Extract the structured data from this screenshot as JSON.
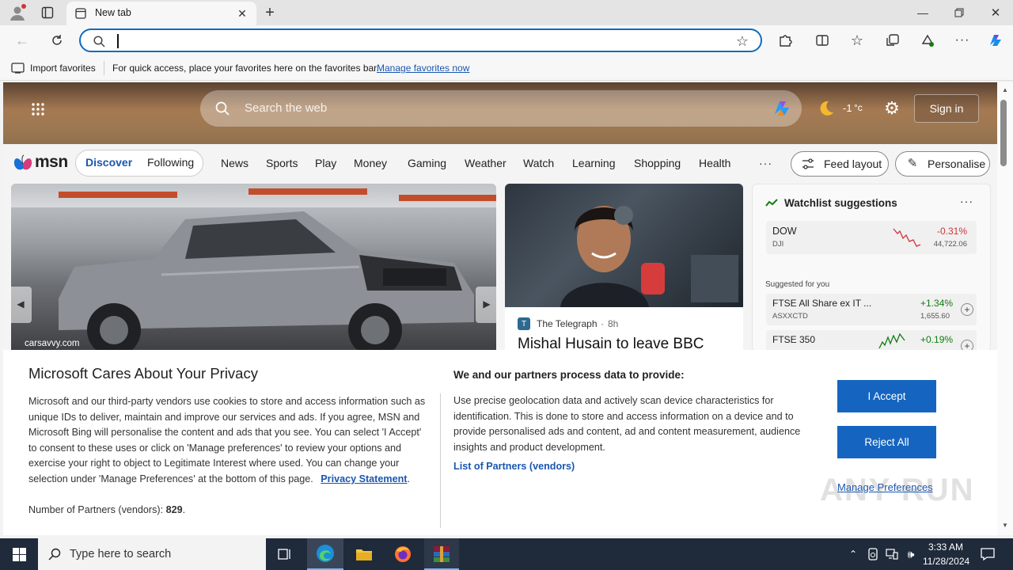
{
  "browser": {
    "tab_title": "New tab",
    "address_value": "",
    "favorites_bar": {
      "import_label": "Import favorites",
      "message": "For quick access, place your favorites here on the favorites bar.",
      "manage_link": "Manage favorites now"
    }
  },
  "msn": {
    "search_placeholder": "Search the web",
    "temperature": "-1",
    "temp_unit": "°c",
    "sign_in": "Sign in",
    "logo": "msn",
    "tabs": [
      "Discover",
      "Following"
    ],
    "nav": [
      "News",
      "Sports",
      "Play",
      "Money",
      "Gaming",
      "Weather",
      "Watch",
      "Learning",
      "Shopping",
      "Health"
    ],
    "more": "···",
    "feed_layout": "Feed layout",
    "personalise": "Personalise",
    "hero_card": {
      "source": "carsavvy.com"
    },
    "news_card": {
      "source": "The Telegraph",
      "age": "8h",
      "headline": "Mishal Husain to leave BBC"
    },
    "watchlist": {
      "title": "Watchlist suggestions",
      "main": {
        "name": "DOW",
        "symbol": "DJI",
        "change": "-0.31%",
        "value": "44,722.06"
      },
      "suggested_label": "Suggested for you",
      "items": [
        {
          "name": "FTSE All Share ex IT ...",
          "symbol": "ASXXCTD",
          "change": "+1.34%",
          "value": "1,655.60"
        },
        {
          "name": "FTSE 350",
          "symbol": "",
          "change": "+0.19%",
          "value": ""
        }
      ],
      "colors": {
        "down": "#d13438",
        "up": "#107c10"
      }
    }
  },
  "cookie": {
    "title": "Microsoft Cares About Your Privacy",
    "body": "Microsoft and our third-party vendors use cookies to store and access information such as unique IDs to deliver, maintain and improve our services and ads. If you agree, MSN and Microsoft Bing will personalise the content and ads that you see. You can select 'I Accept' to consent to these uses or click on 'Manage preferences' to review your options and exercise your right to object to Legitimate Interest where used.  You can change your selection under 'Manage Preferences' at the bottom of this page.",
    "privacy_link": "Privacy Statement",
    "partners_label": "Number of Partners (vendors):",
    "partners_count": "829",
    "right_title": "We and our partners process data to provide:",
    "right_body": "Use precise geolocation data and actively scan device characteristics for identification. This is done to store and access information on a device and to provide personalised ads and content, ad and content measurement, audience insights and product development.",
    "partners_link": "List of Partners (vendors)",
    "accept": "I Accept",
    "reject": "Reject All",
    "manage": "Manage Preferences"
  },
  "taskbar": {
    "search_placeholder": "Type here to search",
    "time": "3:33 AM",
    "date": "11/28/2024"
  },
  "watermark": "ANY RUN"
}
